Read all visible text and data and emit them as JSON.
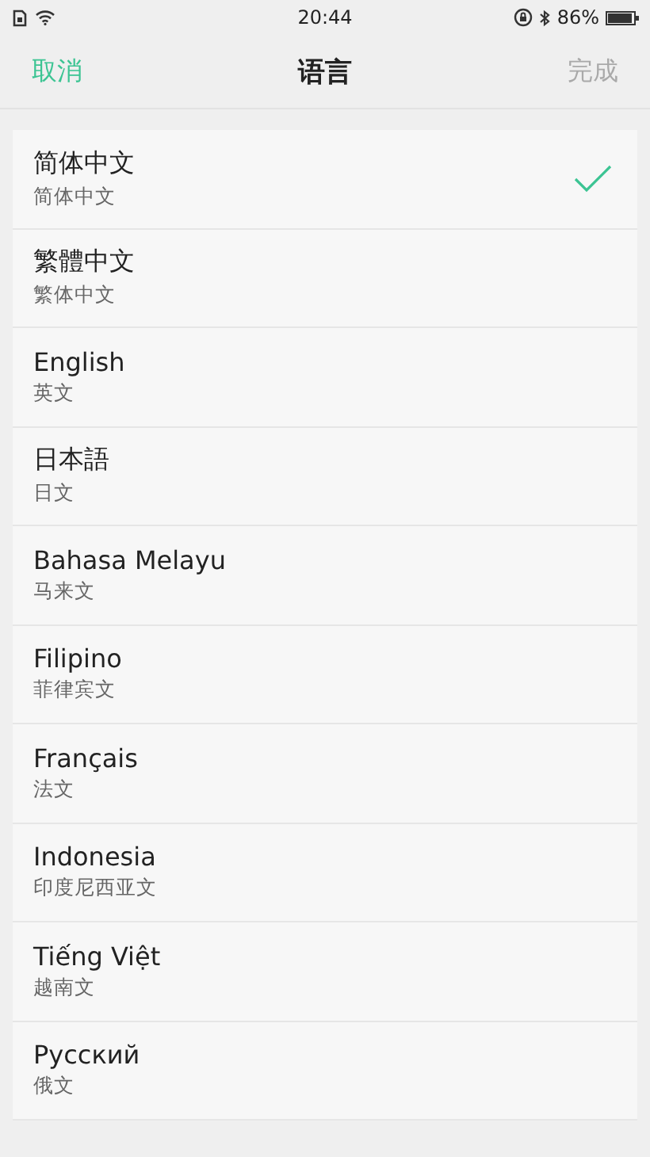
{
  "status_bar": {
    "time": "20:44",
    "battery": "86%"
  },
  "header": {
    "cancel": "取消",
    "title": "语言",
    "done": {
      "label": "完成",
      "disabled": true
    }
  },
  "languages": [
    {
      "name": "简体中文",
      "subtitle": "简体中文",
      "selected": true
    },
    {
      "name": "繁體中文",
      "subtitle": "繁体中文",
      "selected": false
    },
    {
      "name": "English",
      "subtitle": "英文",
      "selected": false
    },
    {
      "name": "日本語",
      "subtitle": "日文",
      "selected": false
    },
    {
      "name": "Bahasa Melayu",
      "subtitle": "马来文",
      "selected": false
    },
    {
      "name": "Filipino",
      "subtitle": "菲律宾文",
      "selected": false
    },
    {
      "name": "Français",
      "subtitle": "法文",
      "selected": false
    },
    {
      "name": "Indonesia",
      "subtitle": "印度尼西亚文",
      "selected": false
    },
    {
      "name": "Tiếng Việt",
      "subtitle": "越南文",
      "selected": false
    },
    {
      "name": "Русский",
      "subtitle": "俄文",
      "selected": false
    }
  ]
}
